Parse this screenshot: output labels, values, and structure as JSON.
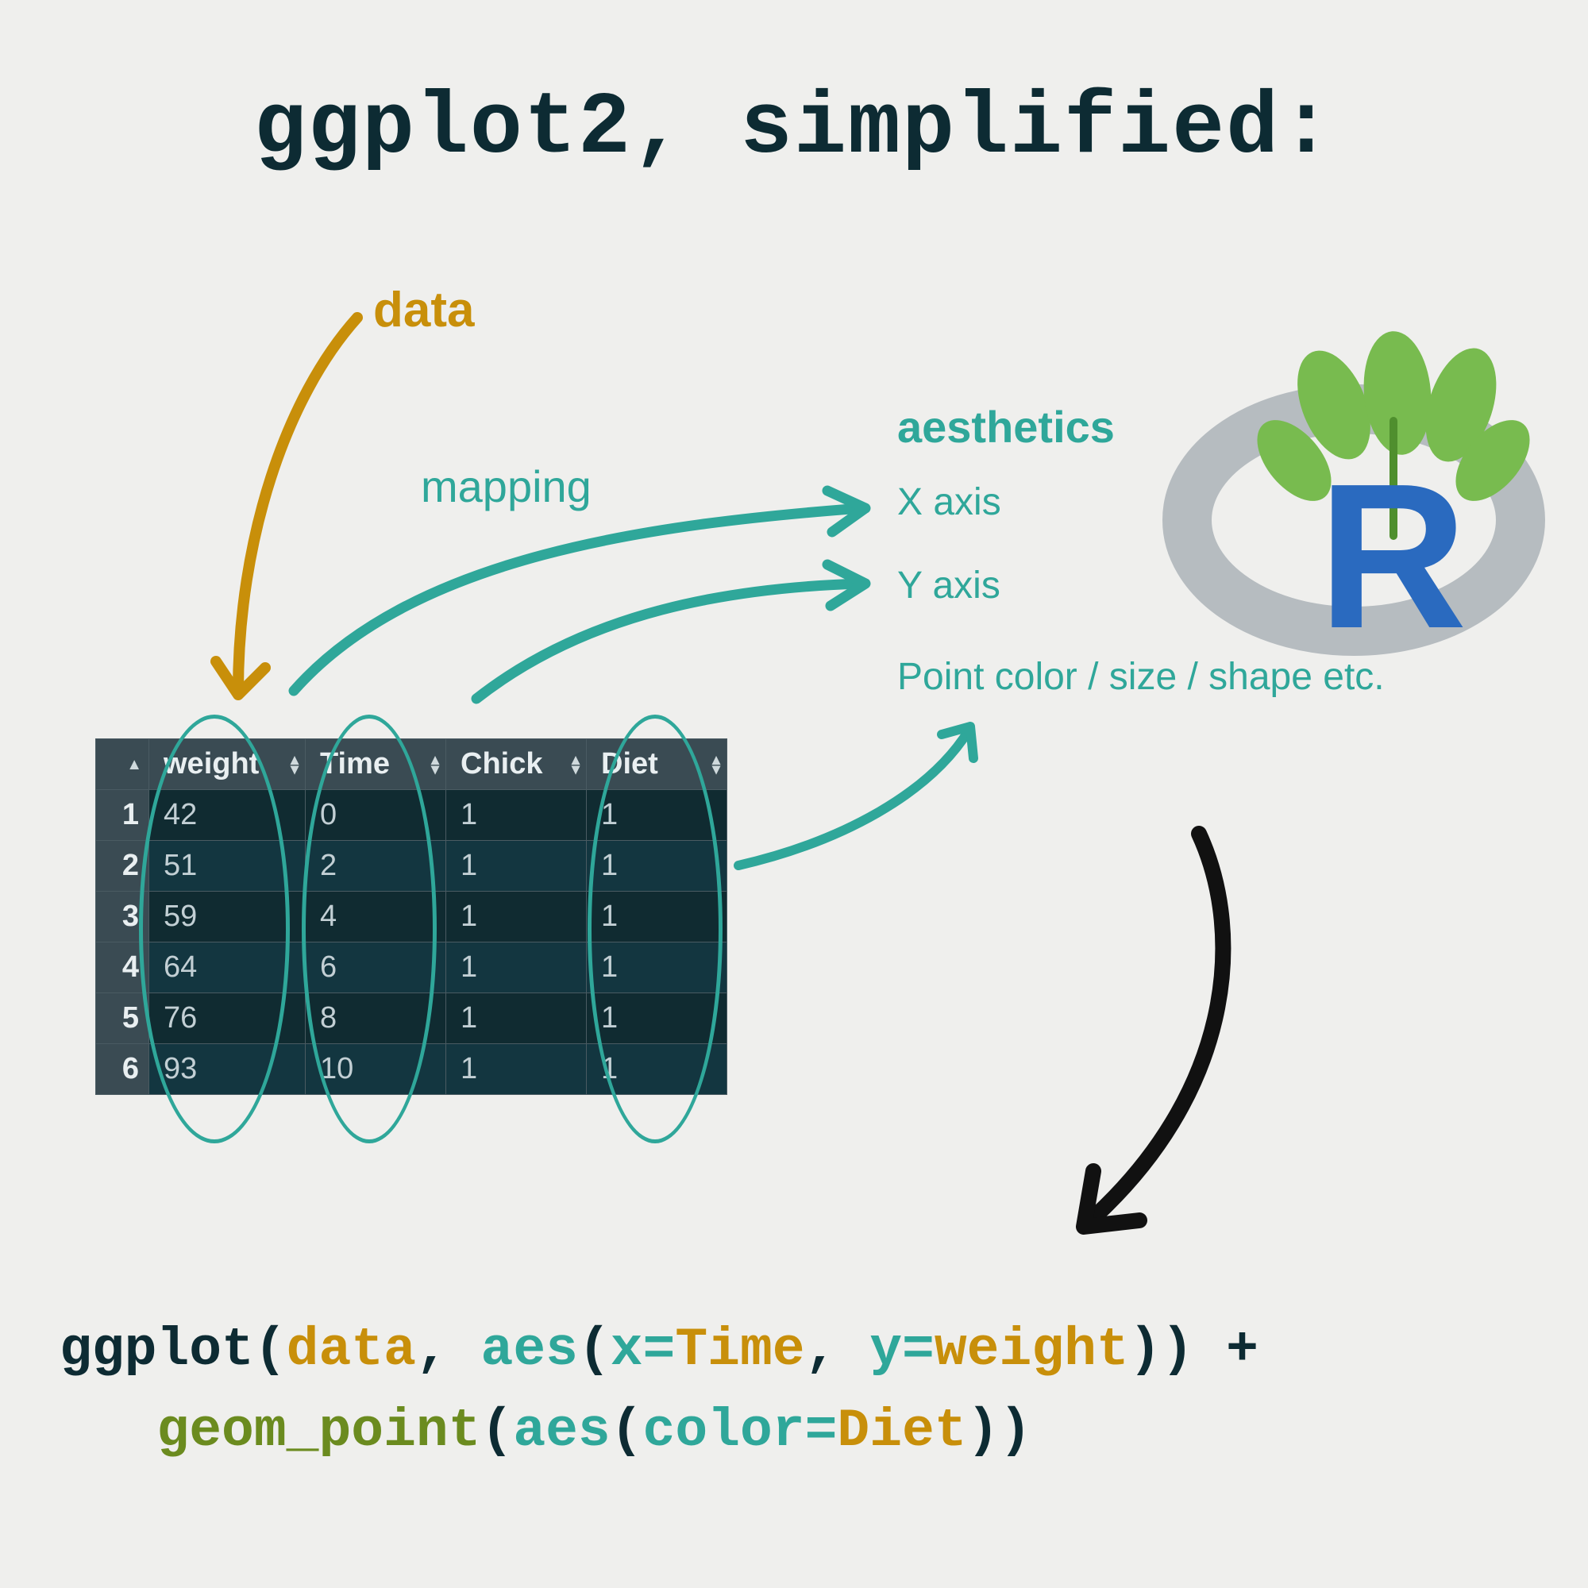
{
  "title": "ggplot2, simplified:",
  "labels": {
    "data": "data",
    "mapping": "mapping",
    "aesthetics": "aesthetics",
    "x": "X axis",
    "y": "Y axis",
    "point": "Point color / size / shape etc."
  },
  "table": {
    "headers": [
      "weight",
      "Time",
      "Chick",
      "Diet"
    ],
    "rows": [
      {
        "i": "1",
        "weight": "42",
        "Time": "0",
        "Chick": "1",
        "Diet": "1"
      },
      {
        "i": "2",
        "weight": "51",
        "Time": "2",
        "Chick": "1",
        "Diet": "1"
      },
      {
        "i": "3",
        "weight": "59",
        "Time": "4",
        "Chick": "1",
        "Diet": "1"
      },
      {
        "i": "4",
        "weight": "64",
        "Time": "6",
        "Chick": "1",
        "Diet": "1"
      },
      {
        "i": "5",
        "weight": "76",
        "Time": "8",
        "Chick": "1",
        "Diet": "1"
      },
      {
        "i": "6",
        "weight": "93",
        "Time": "10",
        "Chick": "1",
        "Diet": "1"
      }
    ]
  },
  "code": {
    "t": {
      "ggplot": "ggplot",
      "open": "(",
      "close": ")",
      "data": "data",
      "comma_sp": ", ",
      "aes": "aes",
      "x_eq": "x=",
      "Time": "Time",
      "y_eq": "y=",
      "weight": "weight",
      "plus": " +",
      "indent": "   ",
      "geom_point": "geom_point",
      "color_eq": "color=",
      "Diet": "Diet"
    }
  },
  "logo": {
    "letter": "R"
  },
  "colors": {
    "bg": "#efefed",
    "ink": "#0d2b33",
    "gold": "#c88f0a",
    "teal": "#2fa79a",
    "olive": "#6b8b1f",
    "blue": "#2a6abf",
    "leaf": "#78bb4f"
  }
}
